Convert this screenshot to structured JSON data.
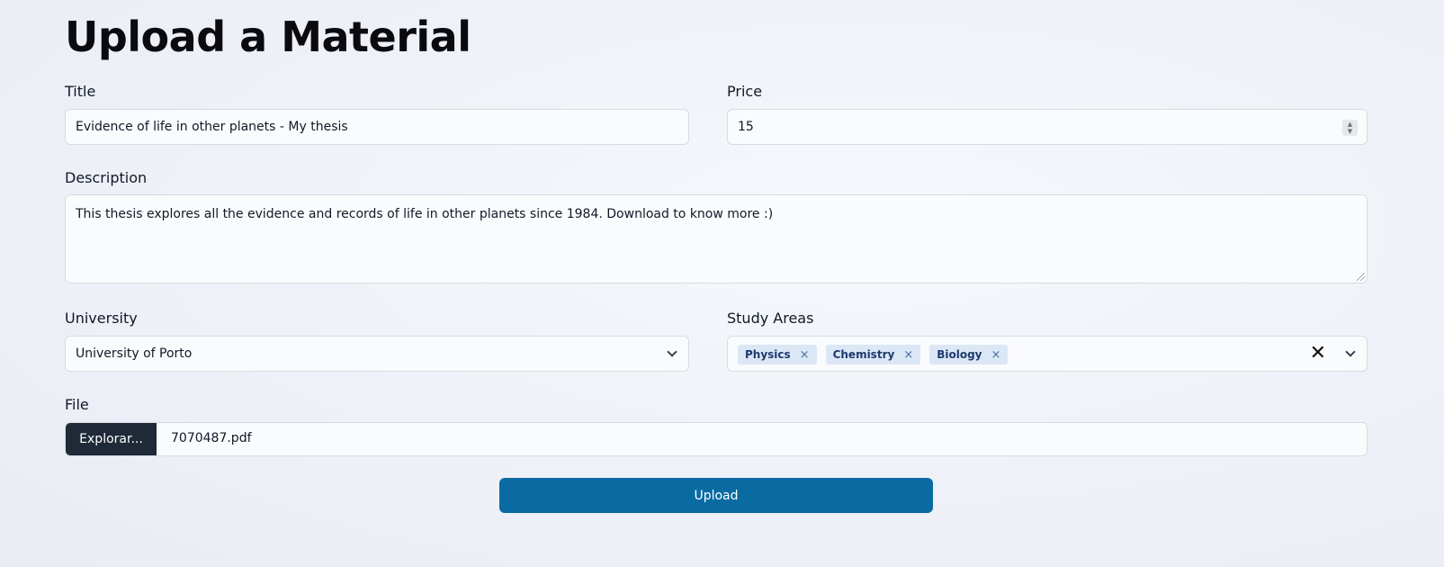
{
  "page_title": "Upload a Material",
  "form": {
    "title": {
      "label": "Title",
      "value": "Evidence of life in other planets - My thesis"
    },
    "price": {
      "label": "Price",
      "value": "15"
    },
    "description": {
      "label": "Description",
      "value": "This thesis explores all the evidence and records of life in other planets since 1984. Download to know more :)"
    },
    "university": {
      "label": "University",
      "value": "University of Porto"
    },
    "study_areas": {
      "label": "Study Areas",
      "selected": [
        "Physics",
        "Chemistry",
        "Biology"
      ],
      "remove_glyph": "×",
      "clear_glyph": "✕"
    },
    "file": {
      "label": "File",
      "button_label": "Explorar...",
      "file_name": "7070487.pdf"
    },
    "submit_label": "Upload"
  },
  "colors": {
    "primary_button": "#0a6ba3",
    "file_button": "#1f2937",
    "chip_bg": "#dbe7f5",
    "chip_text": "#1e3a6e"
  },
  "icons": {
    "university_select": "chevron-down-icon",
    "study_areas_select": "chevron-down-icon",
    "study_areas_clear": "close-icon",
    "chip_remove": "close-icon",
    "price_stepper": "stepper-icon",
    "description_resize": "resize-handle-icon"
  }
}
